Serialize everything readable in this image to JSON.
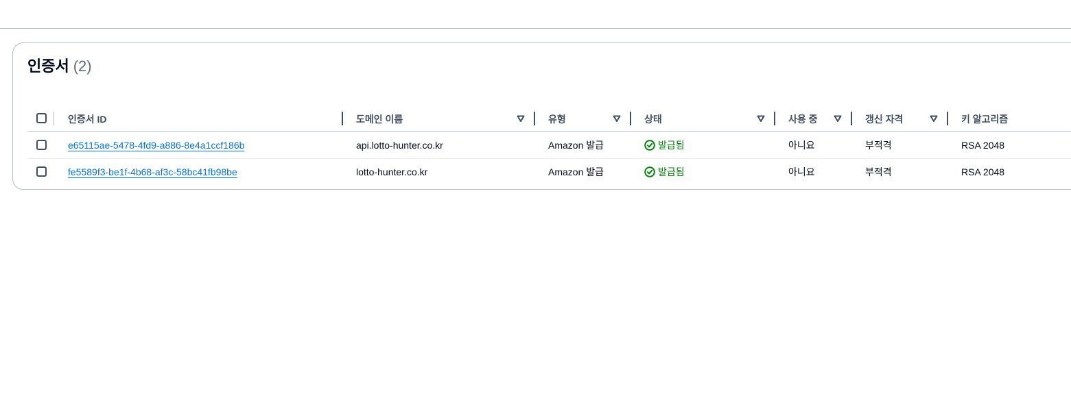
{
  "panel": {
    "title": "인증서",
    "count": "(2)"
  },
  "table": {
    "columns": [
      {
        "label": "인증서 ID"
      },
      {
        "label": "도메인 이름"
      },
      {
        "label": "유형"
      },
      {
        "label": "상태"
      },
      {
        "label": "사용 중"
      },
      {
        "label": "갱신 자격"
      },
      {
        "label": "키 알고리즘"
      }
    ],
    "rows": [
      {
        "id": "e65115ae-5478-4fd9-a886-8e4a1ccf186b",
        "domain": "api.lotto-hunter.co.kr",
        "type": "Amazon 발급",
        "status": "발급됨",
        "in_use": "아니요",
        "renewal": "부적격",
        "key_algorithm": "RSA 2048"
      },
      {
        "id": "fe5589f3-be1f-4b68-af3c-58bc41fb98be",
        "domain": "lotto-hunter.co.kr",
        "type": "Amazon 발급",
        "status": "발급됨",
        "in_use": "아니요",
        "renewal": "부적격",
        "key_algorithm": "RSA 2048"
      }
    ]
  },
  "colors": {
    "link": "#0972d3",
    "success": "#037f0c",
    "border": "#b6bec9",
    "text": "#000716"
  },
  "icons": {
    "sort": "sort-caret-down-icon",
    "status": "status-positive-icon"
  }
}
